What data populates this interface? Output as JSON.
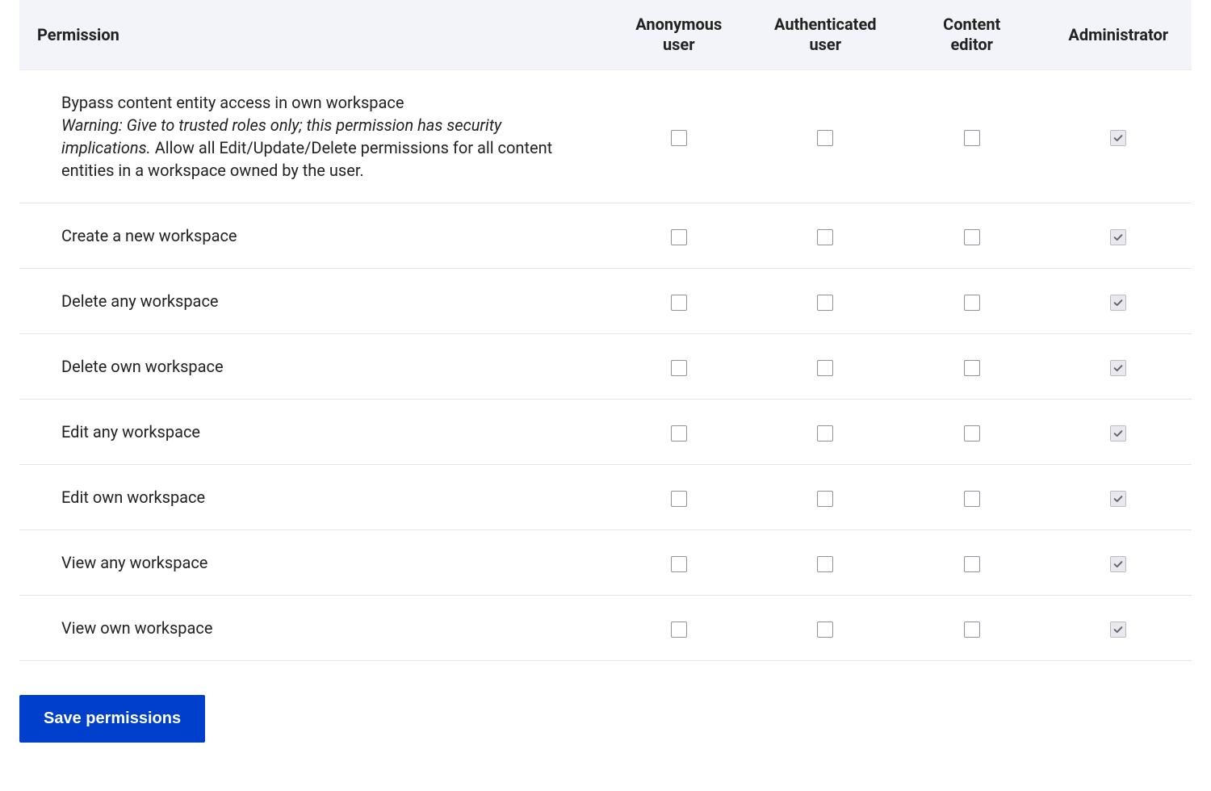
{
  "table": {
    "header_permission": "Permission",
    "roles": [
      {
        "key": "anonymous",
        "label_line1": "Anonymous",
        "label_line2": "user"
      },
      {
        "key": "authenticated",
        "label_line1": "Authenticated",
        "label_line2": "user"
      },
      {
        "key": "content_editor",
        "label_line1": "Content",
        "label_line2": "editor"
      },
      {
        "key": "administrator",
        "label_line1": "Administrator",
        "label_line2": ""
      }
    ],
    "rows": [
      {
        "title": "Bypass content entity access in own workspace",
        "warning": "Warning: Give to trusted roles only; this permission has security implications.",
        "desc": " Allow all Edit/Update/Delete permissions for all content entities in a workspace owned by the user.",
        "anonymous": {
          "checked": false,
          "disabled": false
        },
        "authenticated": {
          "checked": false,
          "disabled": false
        },
        "content_editor": {
          "checked": false,
          "disabled": false
        },
        "administrator": {
          "checked": true,
          "disabled": true
        }
      },
      {
        "title": "Create a new workspace",
        "anonymous": {
          "checked": false,
          "disabled": false
        },
        "authenticated": {
          "checked": false,
          "disabled": false
        },
        "content_editor": {
          "checked": false,
          "disabled": false
        },
        "administrator": {
          "checked": true,
          "disabled": true
        }
      },
      {
        "title": "Delete any workspace",
        "anonymous": {
          "checked": false,
          "disabled": false
        },
        "authenticated": {
          "checked": false,
          "disabled": false
        },
        "content_editor": {
          "checked": false,
          "disabled": false
        },
        "administrator": {
          "checked": true,
          "disabled": true
        }
      },
      {
        "title": "Delete own workspace",
        "anonymous": {
          "checked": false,
          "disabled": false
        },
        "authenticated": {
          "checked": false,
          "disabled": false
        },
        "content_editor": {
          "checked": false,
          "disabled": false
        },
        "administrator": {
          "checked": true,
          "disabled": true
        }
      },
      {
        "title": "Edit any workspace",
        "anonymous": {
          "checked": false,
          "disabled": false
        },
        "authenticated": {
          "checked": false,
          "disabled": false
        },
        "content_editor": {
          "checked": false,
          "disabled": false
        },
        "administrator": {
          "checked": true,
          "disabled": true
        }
      },
      {
        "title": "Edit own workspace",
        "anonymous": {
          "checked": false,
          "disabled": false
        },
        "authenticated": {
          "checked": false,
          "disabled": false
        },
        "content_editor": {
          "checked": false,
          "disabled": false
        },
        "administrator": {
          "checked": true,
          "disabled": true
        }
      },
      {
        "title": "View any workspace",
        "anonymous": {
          "checked": false,
          "disabled": false
        },
        "authenticated": {
          "checked": false,
          "disabled": false
        },
        "content_editor": {
          "checked": false,
          "disabled": false
        },
        "administrator": {
          "checked": true,
          "disabled": true
        }
      },
      {
        "title": "View own workspace",
        "anonymous": {
          "checked": false,
          "disabled": false
        },
        "authenticated": {
          "checked": false,
          "disabled": false
        },
        "content_editor": {
          "checked": false,
          "disabled": false
        },
        "administrator": {
          "checked": true,
          "disabled": true
        }
      }
    ]
  },
  "actions": {
    "save_label": "Save permissions"
  }
}
